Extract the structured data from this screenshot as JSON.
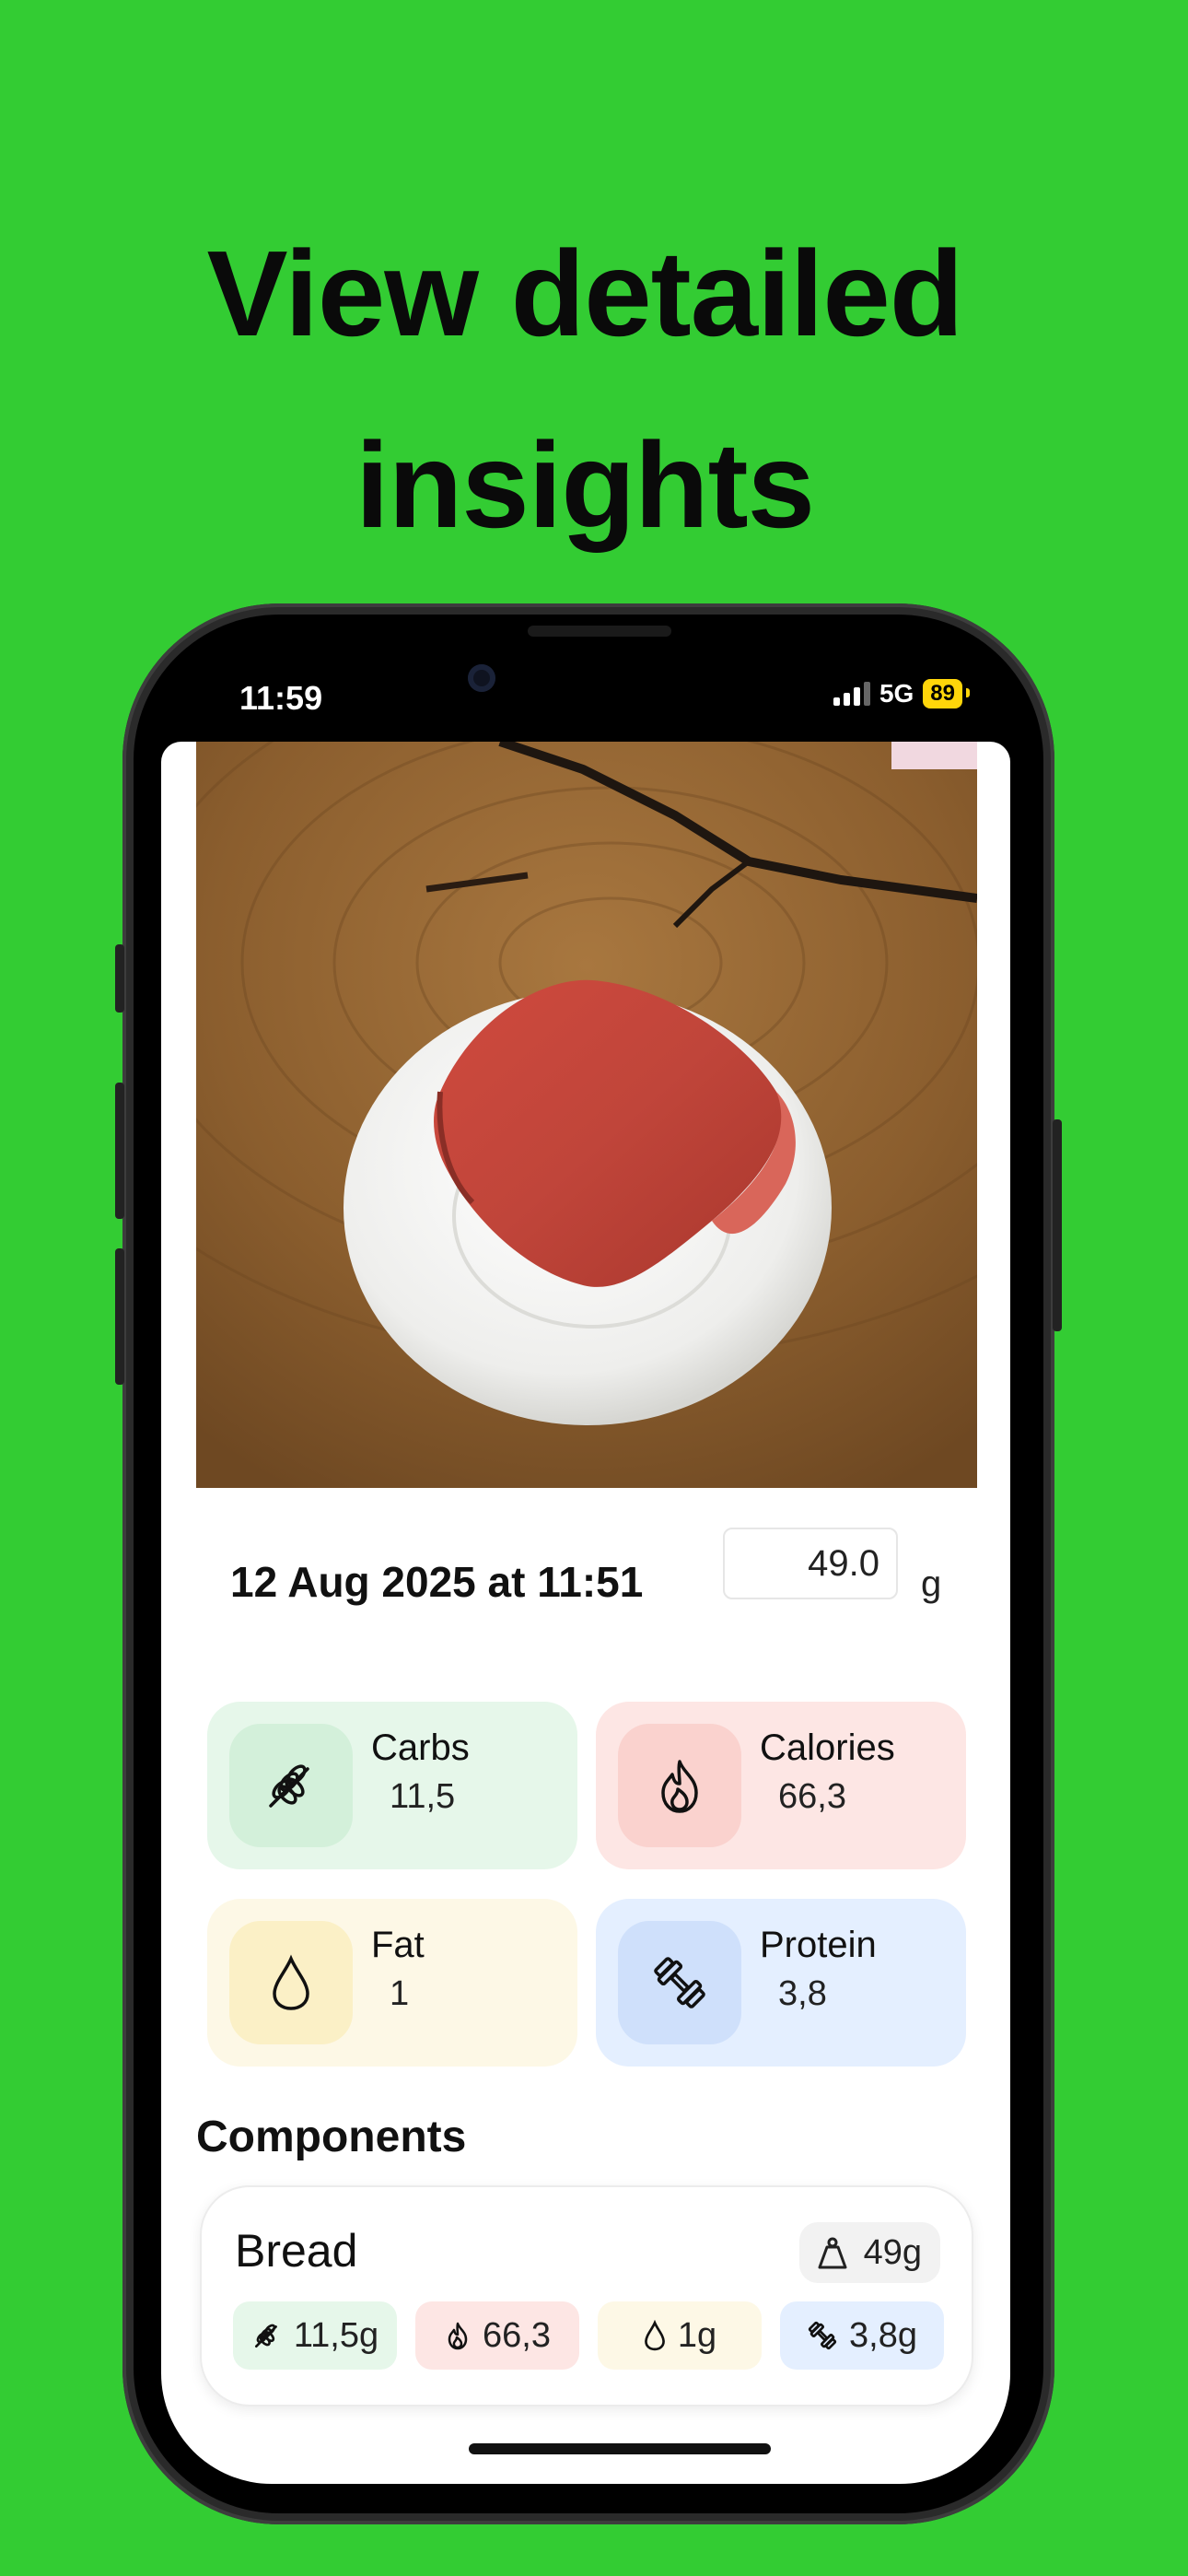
{
  "headline": {
    "line1": "View detailed",
    "line2": "insights"
  },
  "status_bar": {
    "time": "11:59",
    "network": "5G",
    "battery": "89"
  },
  "meal": {
    "photo_description_icon": "food-photo",
    "date": "12 Aug 2025 at 11:51",
    "weight_value": "49.0",
    "weight_unit": "g"
  },
  "nutrients": [
    {
      "label": "Carbs",
      "value": "11,5",
      "icon": "wheat-icon"
    },
    {
      "label": "Calories",
      "value": "66,3",
      "icon": "flame-icon"
    },
    {
      "label": "Fat",
      "value": "1",
      "icon": "drop-icon"
    },
    {
      "label": "Protein",
      "value": "3,8",
      "icon": "dumbbell-icon"
    }
  ],
  "components": {
    "title": "Components",
    "items": [
      {
        "name": "Bread",
        "weight": "49g",
        "carbs": "11,5g",
        "calories": "66,3",
        "fat": "1g",
        "protein": "3,8g"
      }
    ]
  },
  "colors": {
    "background": "#33cc33",
    "carbs": "#e6f7ea",
    "calories": "#fde6e4",
    "fat": "#fdf8e6",
    "protein": "#e4efff",
    "battery": "#ffd60a"
  }
}
